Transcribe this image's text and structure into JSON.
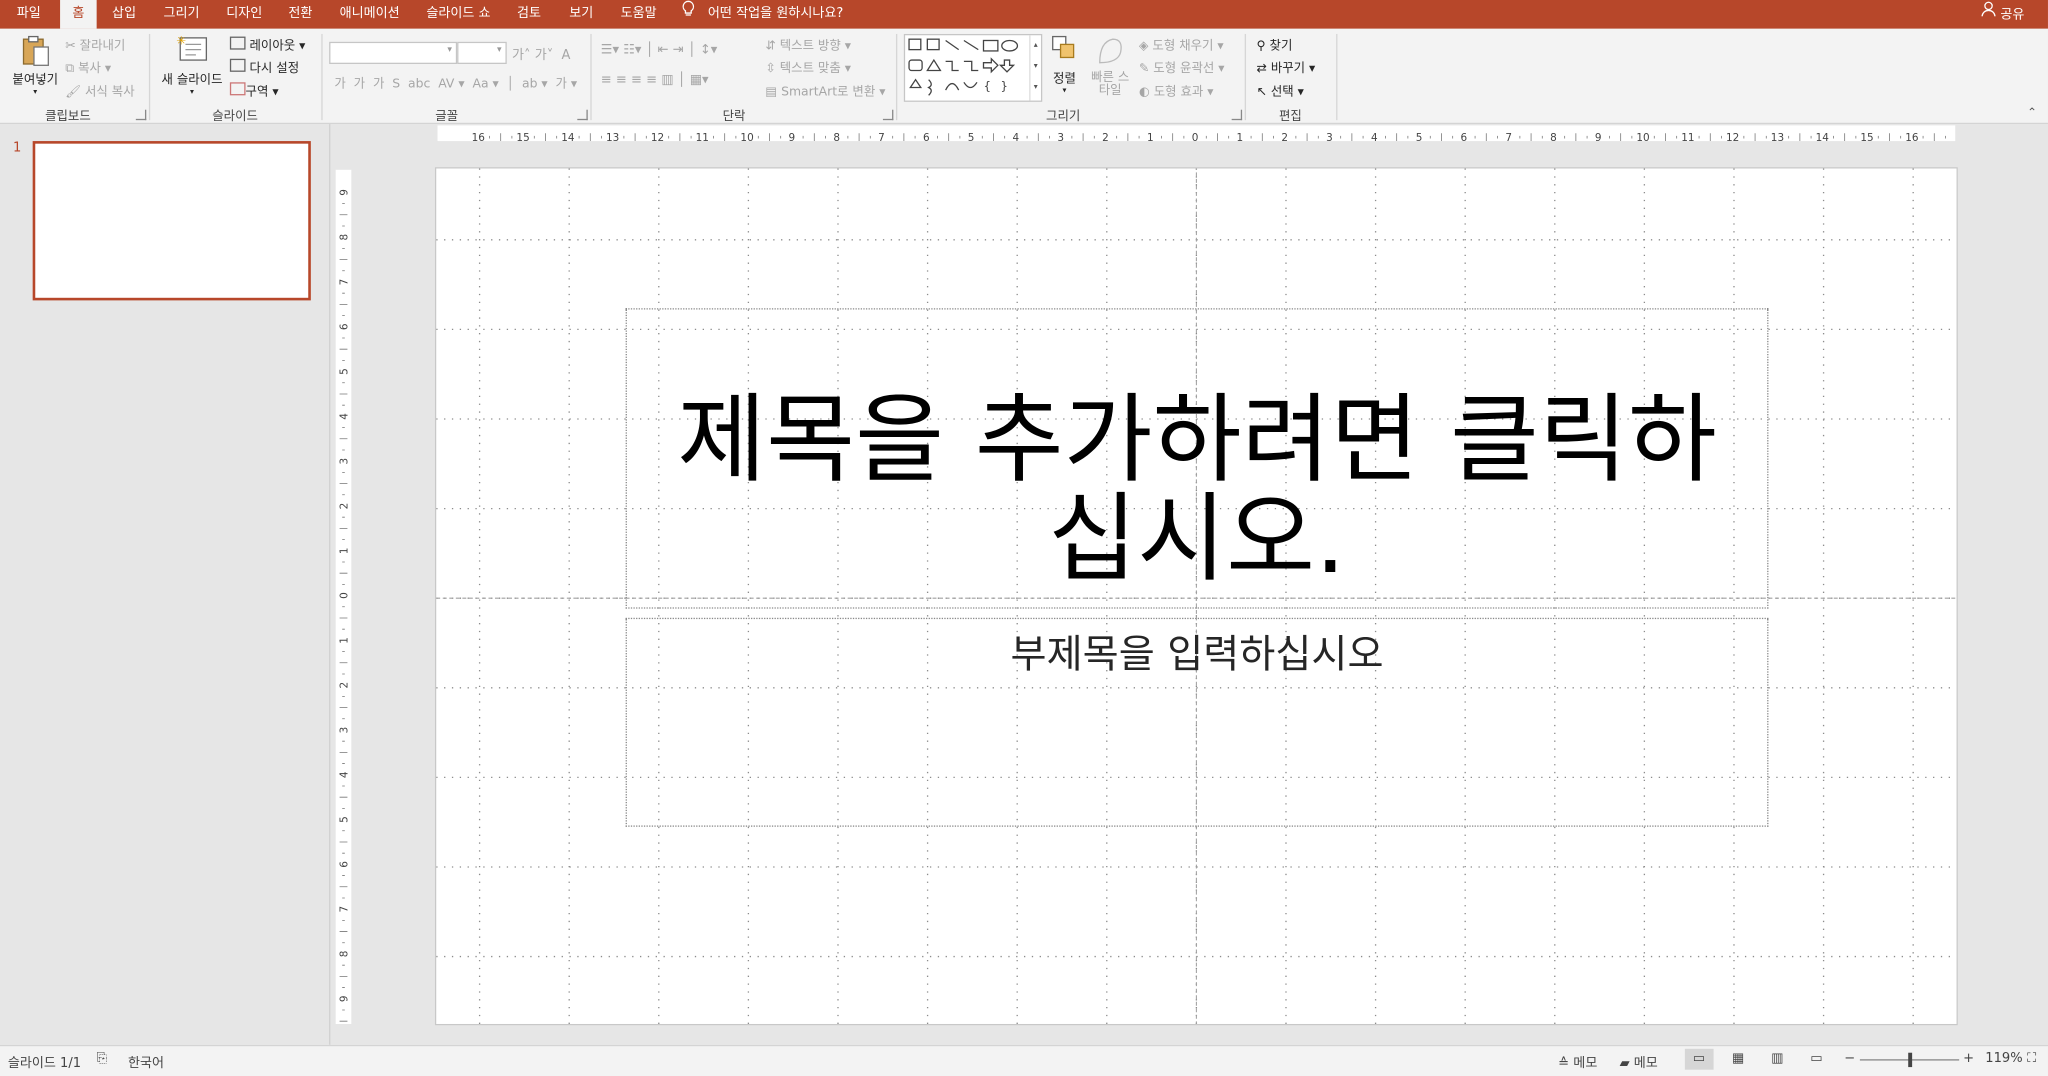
{
  "tabs": [
    {
      "label": "파일",
      "active": false
    },
    {
      "label": "홈",
      "active": true
    },
    {
      "label": "삽입",
      "active": false
    },
    {
      "label": "그리기",
      "active": false
    },
    {
      "label": "디자인",
      "active": false
    },
    {
      "label": "전환",
      "active": false
    },
    {
      "label": "애니메이션",
      "active": false
    },
    {
      "label": "슬라이드 쇼",
      "active": false
    },
    {
      "label": "검토",
      "active": false
    },
    {
      "label": "보기",
      "active": false
    },
    {
      "label": "도움말",
      "active": false
    }
  ],
  "tellme": "어떤 작업을 원하시나요?",
  "share": "공유",
  "ribbon": {
    "clipboard": {
      "paste": "붙여넣기",
      "cut": "잘라내기",
      "copy": "복사",
      "format_painter": "서식 복사",
      "label": "클립보드"
    },
    "slides": {
      "new_slide": "새 슬라이드",
      "layout": "레이아웃",
      "reset": "다시 설정",
      "section": "구역",
      "label": "슬라이드"
    },
    "font": {
      "label": "글꼴"
    },
    "paragraph": {
      "text_direction": "텍스트 방향",
      "align_text": "텍스트 맞춤",
      "smartart": "SmartArt로 변환",
      "label": "단락"
    },
    "drawing": {
      "arrange": "정렬",
      "quick_styles": "빠른 스타일",
      "shape_fill": "도형 채우기",
      "shape_outline": "도형 윤곽선",
      "shape_effects": "도형 효과",
      "label": "그리기"
    },
    "editing": {
      "find": "찾기",
      "replace": "바꾸기",
      "select": "선택",
      "label": "편집"
    }
  },
  "thumbnail": {
    "number": "1"
  },
  "slide": {
    "title_line1": "제목을 추가하려면 클릭하",
    "title_line2": "십시오.",
    "subtitle": "부제목을 입력하십시오"
  },
  "status": {
    "slide_info": "슬라이드 1/1",
    "language": "한국어",
    "notes": "메모",
    "comments": "메모",
    "zoom": "119%"
  },
  "colors": {
    "accent": "#b7472a",
    "ribbon_bg": "#f3f3f3"
  }
}
